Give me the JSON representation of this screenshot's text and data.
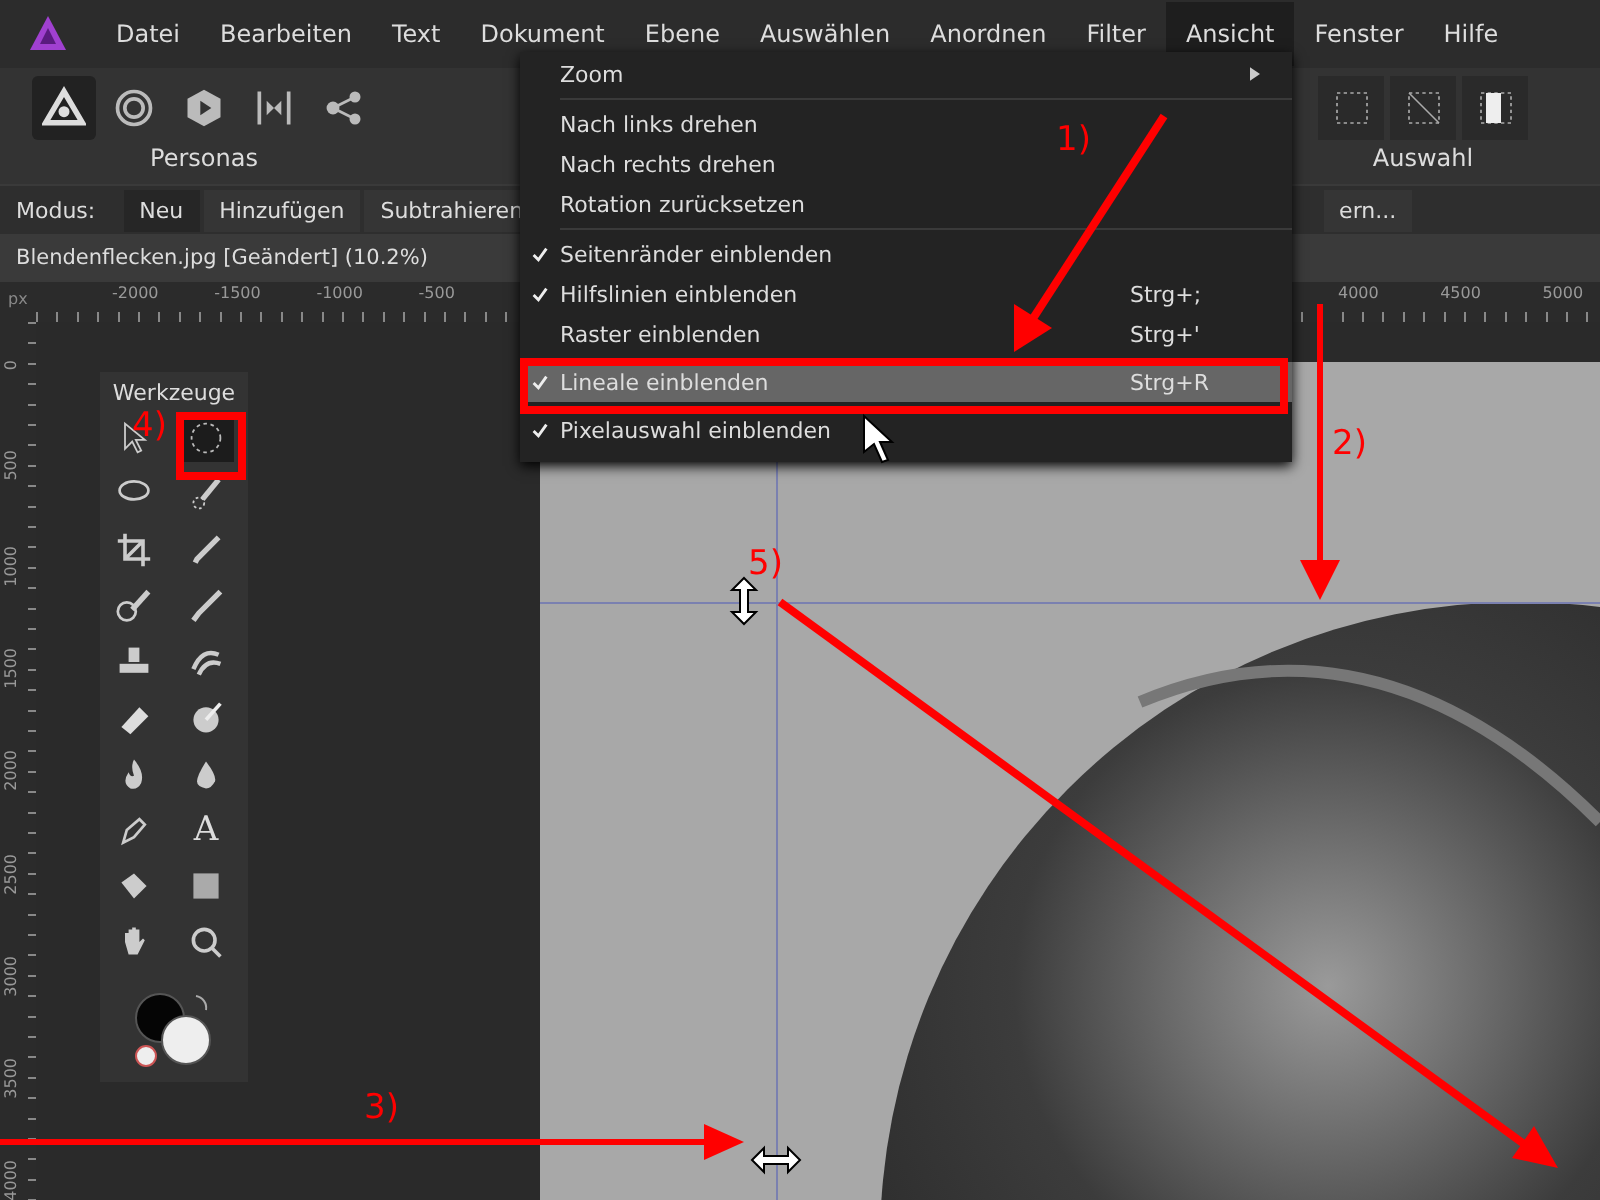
{
  "menu_bar": {
    "items": [
      {
        "label": "Datei",
        "selected": false
      },
      {
        "label": "Bearbeiten",
        "selected": false
      },
      {
        "label": "Text",
        "selected": false
      },
      {
        "label": "Dokument",
        "selected": false
      },
      {
        "label": "Ebene",
        "selected": false
      },
      {
        "label": "Auswählen",
        "selected": false
      },
      {
        "label": "Anordnen",
        "selected": false
      },
      {
        "label": "Filter",
        "selected": false
      },
      {
        "label": "Ansicht",
        "selected": true
      },
      {
        "label": "Fenster",
        "selected": false
      },
      {
        "label": "Hilfe",
        "selected": false
      }
    ]
  },
  "personas": {
    "label": "Personas",
    "items": [
      {
        "kind": "photo",
        "selected": true
      },
      {
        "kind": "liquify",
        "selected": false
      },
      {
        "kind": "develop",
        "selected": false
      },
      {
        "kind": "tonemap",
        "selected": false
      },
      {
        "kind": "export",
        "selected": false
      }
    ]
  },
  "selection_group": {
    "label": "Auswahl",
    "items": [
      {
        "kind": "all"
      },
      {
        "kind": "none"
      },
      {
        "kind": "invert"
      }
    ]
  },
  "mode_bar": {
    "label": "Modus:",
    "buttons": [
      {
        "label": "Neu",
        "selected": true
      },
      {
        "label": "Hinzufügen",
        "selected": false
      },
      {
        "label": "Subtrahieren",
        "selected": false
      }
    ],
    "cut_button": "ern..."
  },
  "document_tab": {
    "title": "Blendenflecken.jpg [Geändert] (10.2%)"
  },
  "rulers": {
    "unit": "px",
    "top_left_labels": [
      "-2000",
      "-1500",
      "-1000",
      "-500"
    ],
    "top_right_labels": [
      "4000",
      "4500",
      "5000"
    ],
    "left_labels": [
      "0",
      "500",
      "1000",
      "1500",
      "2000",
      "2500",
      "3000",
      "3500",
      "4000"
    ]
  },
  "tools_panel": {
    "title": "Werkzeuge",
    "tools": [
      {
        "kind": "move",
        "selected": false
      },
      {
        "kind": "marquee",
        "selected": true
      },
      {
        "kind": "lasso",
        "selected": false
      },
      {
        "kind": "selection-brush",
        "selected": false
      },
      {
        "kind": "crop",
        "selected": false
      },
      {
        "kind": "picker",
        "selected": false
      },
      {
        "kind": "paint-mixer",
        "selected": false
      },
      {
        "kind": "brush",
        "selected": false
      },
      {
        "kind": "stamp",
        "selected": false
      },
      {
        "kind": "smudge",
        "selected": false
      },
      {
        "kind": "eraser",
        "selected": false
      },
      {
        "kind": "dodge",
        "selected": false
      },
      {
        "kind": "flame",
        "selected": false
      },
      {
        "kind": "drop",
        "selected": false
      },
      {
        "kind": "pen",
        "selected": false
      },
      {
        "kind": "text",
        "glyph": "A",
        "selected": false
      },
      {
        "kind": "fill",
        "selected": false
      },
      {
        "kind": "gradient",
        "selected": false
      },
      {
        "kind": "hand",
        "selected": false
      },
      {
        "kind": "zoom",
        "selected": false
      }
    ]
  },
  "view_menu": {
    "items": [
      {
        "kind": "item",
        "label": "Zoom",
        "submenu": true,
        "checked": false,
        "selected": false
      },
      {
        "kind": "separator"
      },
      {
        "kind": "item",
        "label": "Nach links drehen",
        "checked": false,
        "selected": false
      },
      {
        "kind": "item",
        "label": "Nach rechts drehen",
        "checked": false,
        "selected": false
      },
      {
        "kind": "item",
        "label": "Rotation zurücksetzen",
        "checked": false,
        "selected": false
      },
      {
        "kind": "separator"
      },
      {
        "kind": "item",
        "label": "Seitenränder einblenden",
        "checked": true,
        "selected": false
      },
      {
        "kind": "item",
        "label": "Hilfslinien einblenden",
        "shortcut": "Strg+;",
        "checked": true,
        "selected": false
      },
      {
        "kind": "item",
        "label": "Raster einblenden",
        "shortcut": "Strg+'",
        "checked": false,
        "selected": false
      },
      {
        "kind": "item",
        "label": "Lineale einblenden",
        "shortcut": "Strg+R",
        "checked": true,
        "selected": true
      },
      {
        "kind": "item",
        "label": "Pixelauswahl einblenden",
        "checked": true,
        "selected": false
      }
    ]
  },
  "annotations": [
    "1)",
    "2)",
    "3)",
    "4)",
    "5)"
  ]
}
